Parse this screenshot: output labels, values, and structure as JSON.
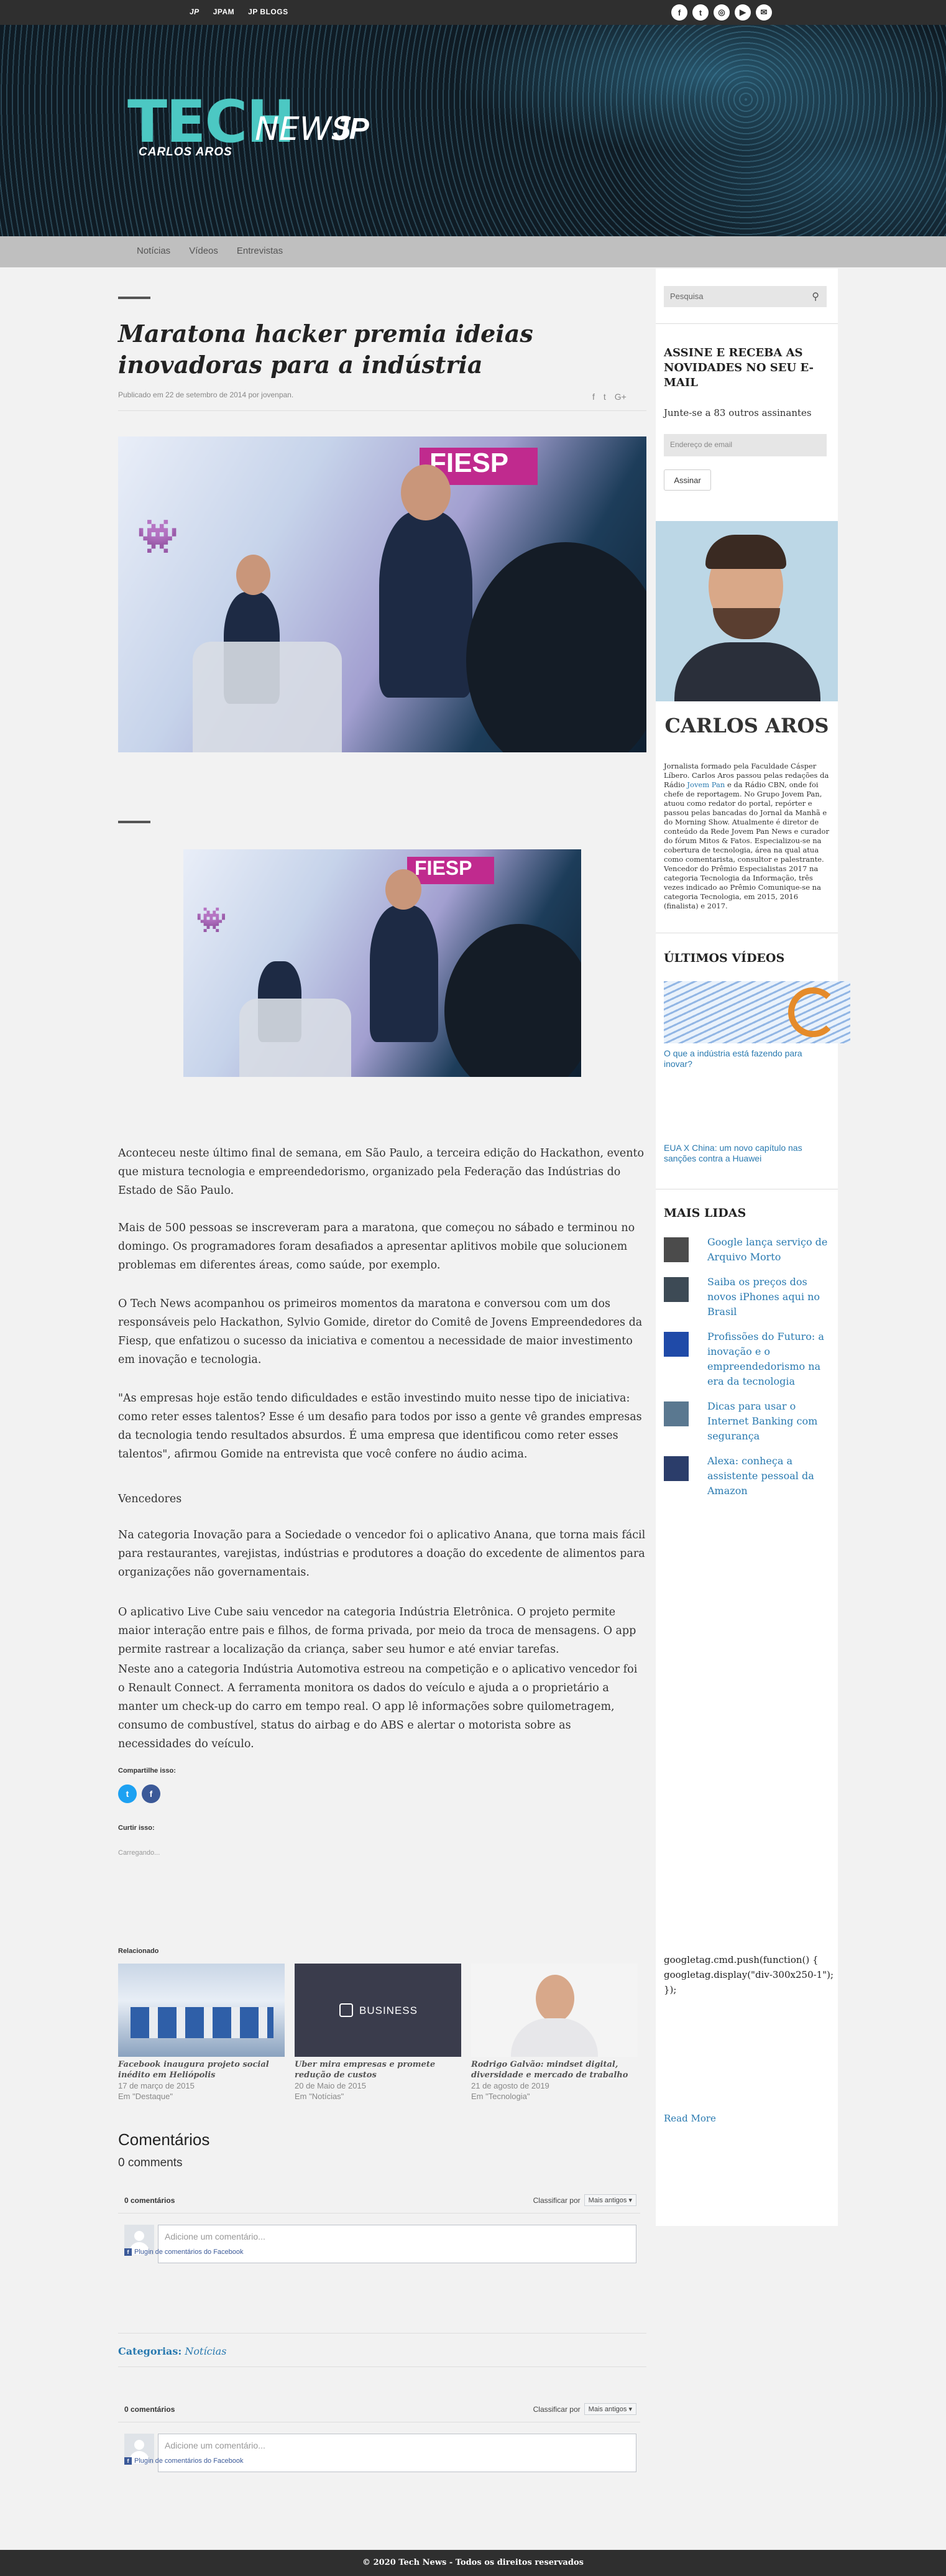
{
  "topbar": {
    "logo": "JP",
    "links": [
      "JPAM",
      "JP BLOGS"
    ],
    "social": [
      "f",
      "t",
      "◎",
      "▶",
      "✉"
    ]
  },
  "hero": {
    "logo_tech": "TECH",
    "logo_news": "NEWS",
    "logo_jp": "JP",
    "author": "CARLOS AROS"
  },
  "nav": {
    "items": [
      "Notícias",
      "Vídeos",
      "Entrevistas"
    ]
  },
  "article": {
    "title": "Maratona hacker premia ideias inovadoras para a indústria",
    "published": "Publicado em 22 de setembro de 2014 por jovenpan.",
    "share_mini": [
      "f",
      "t",
      "G+"
    ],
    "photo_label": "FIESP",
    "paragraphs": [
      "Aconteceu neste último final de semana, em São Paulo, a terceira edição do Hackathon, evento que mistura tecnologia e empreendedorismo, organizado pela Federação das Indústrias do Estado de São Paulo.",
      "Mais de 500 pessoas se inscreveram para a maratona, que começou no sábado e terminou no domingo. Os programadores foram desafiados a apresentar aplitivos mobile que solucionem problemas em diferentes áreas, como saúde, por exemplo.",
      "O Tech News acompanhou os primeiros momentos da maratona e conversou com um dos responsáveis pelo Hackathon, Sylvio Gomide, diretor do Comitê de Jovens Empreendedores da Fiesp, que enfatizou o sucesso da iniciativa e comentou a necessidade de maior investimento em inovação e tecnologia.",
      "\"As empresas hoje estão tendo dificuldades e estão investindo muito nesse tipo de iniciativa: como reter esses talentos? Esse é um desafio para todos por isso a gente vê grandes empresas da tecnologia tendo resultados absurdos. É uma empresa que identificou como reter esses talentos\", afirmou Gomide na entrevista que você confere no áudio acima.",
      "Vencedores",
      "Na categoria Inovação para a Sociedade o vencedor foi o aplicativo Anana, que torna mais fácil para restaurantes, varejistas, indústrias e produtores a doação do excedente de alimentos para organizações não governamentais.",
      "O aplicativo Live Cube saiu vencedor na categoria Indústria Eletrônica. O projeto permite maior interação entre pais e filhos, de forma privada, por meio da troca de mensagens. O app permite rastrear a localização da criança, saber seu humor e até enviar tarefas.",
      "Neste ano a categoria Indústria Automotiva estreou na competição e o aplicativo vencedor foi o Renault Connect. A ferramenta monitora os dados do veículo e ajuda a o proprietário a manter um check-up do carro em tempo real. O app lê informações sobre quilometragem, consumo de combustível, status do airbag e do ABS e alertar o motorista sobre as necessidades do veículo."
    ],
    "share_title": "Compartilhe isso:",
    "share_buttons": [
      "t",
      "f"
    ],
    "like_title": "Curtir isso:",
    "loading": "Carregando..."
  },
  "related": {
    "title": "Relacionado",
    "items": [
      {
        "title": "Facebook inaugura projeto social inédito em Heliópolis",
        "date": "17 de março de 2015",
        "cat": "Em \"Destaque\""
      },
      {
        "title": "Uber mira empresas e promete redução de custos",
        "date": "20 de Maio de 2015",
        "cat": "Em \"Notícias\"",
        "badge": "BUSINESS"
      },
      {
        "title": "Rodrigo Galvão: mindset digital, diversidade e mercado de trabalho",
        "date": "21 de agosto de 2019",
        "cat": "Em \"Tecnologia\""
      }
    ]
  },
  "comments": {
    "title": "Comentários",
    "count": "0 comments",
    "box": {
      "count": "0 comentários",
      "sort_label": "Classificar por",
      "sort_value": "Mais antigos ▾",
      "placeholder": "Adicione um comentário...",
      "plugin": "Plugin de comentários do Facebook"
    }
  },
  "categories": {
    "label": "Categorias:",
    "value": "Notícias"
  },
  "sidebar": {
    "search_placeholder": "Pesquisa",
    "subscribe_title": "ASSINE E RECEBA AS NOVIDADES NO SEU E-MAIL",
    "subscribe_count": "Junte-se a 83 outros assinantes",
    "email_placeholder": "Endereço de email",
    "subscribe_button": "Assinar",
    "author_name": "CARLOS AROS",
    "bio_a": "Jornalista formado pela Faculdade Cásper Líbero. Carlos Aros passou pelas redações da Rádio ",
    "bio_link1": "Jovem Pan",
    "bio_b": " e da Rádio CBN, onde foi chefe de reportagem. No Grupo Jovem Pan, atuou como redator do portal, repórter e passou pelas bancadas do Jornal da Manhã e do Morning Show. Atualmente é diretor de conteúdo da Rede Jovem Pan News e curador do fórum Mitos & Fatos. Especializou-se na cobertura de tecnologia, área na qual atua como comentarista, consultor e palestrante. Vencedor do Prêmio Especialistas 2017 na categoria Tecnologia da Informação, três vezes indicado ao Prêmio Comunique-se na categoria Tecnologia, em 2015, 2016 (finalista) e 2017.",
    "videos_title": "ÚLTIMOS VÍDEOS",
    "video_links": [
      "O que a indústria está fazendo para inovar?",
      "EUA X China: um novo capítulo nas sanções contra a Huawei"
    ],
    "mais_lidas_title": "MAIS LIDAS",
    "mais_lidas": [
      "Google lança serviço de Arquivo Morto",
      "Saiba os preços dos novos iPhones aqui no Brasil",
      "Profissões do Futuro: a inovação e o empreendedorismo na era da tecnologia",
      "Dicas para usar o Internet Banking com segurança",
      "Alexa: conheça a assistente pessoal da Amazon"
    ],
    "gtag": "googletag.cmd.push(function() { googletag.display(\"div-300x250-1\"); });",
    "read_more": "Read More"
  },
  "footer": {
    "text": "© 2020 Tech News - Todos os direitos reservados"
  },
  "colors": {
    "accent": "#4cc8c3",
    "link": "#2a7ab0",
    "dark": "#2f2f2f"
  }
}
